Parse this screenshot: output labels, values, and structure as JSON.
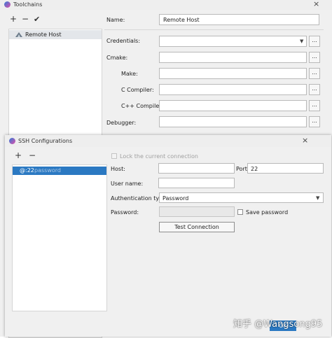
{
  "toolchains": {
    "title": "Toolchains",
    "toolbar": {
      "add": "+",
      "remove": "−",
      "apply": "✔"
    },
    "list": [
      {
        "label": "Remote Host"
      }
    ],
    "form": {
      "name_label": "Name:",
      "name_value": "Remote Host",
      "credentials_label": "Credentials:",
      "cmake_label": "Cmake:",
      "make_label": "Make:",
      "c_compiler_label": "C Compiler:",
      "cpp_compiler_label": "C++ Compiler:",
      "debugger_label": "Debugger:",
      "browse_label": "..."
    }
  },
  "ssh": {
    "title": "SSH Configurations",
    "toolbar": {
      "add": "+",
      "remove": "−"
    },
    "list": [
      {
        "host": "@:22",
        "auth": "password"
      }
    ],
    "lock_label": "Lock the current connection",
    "host_label": "Host:",
    "host_value": "",
    "port_label": "Port:",
    "port_value": "22",
    "username_label": "User name:",
    "username_value": "",
    "auth_type_label": "Authentication type:",
    "auth_type_value": "Password",
    "password_label": "Password:",
    "save_password_label": "Save password",
    "test_connection_label": "Test Connection",
    "ok_label": "OK"
  },
  "watermark": "知乎 @Wangsong95",
  "colors": {
    "selection": "#2b79c2",
    "window_bg": "#f0f0f0"
  }
}
